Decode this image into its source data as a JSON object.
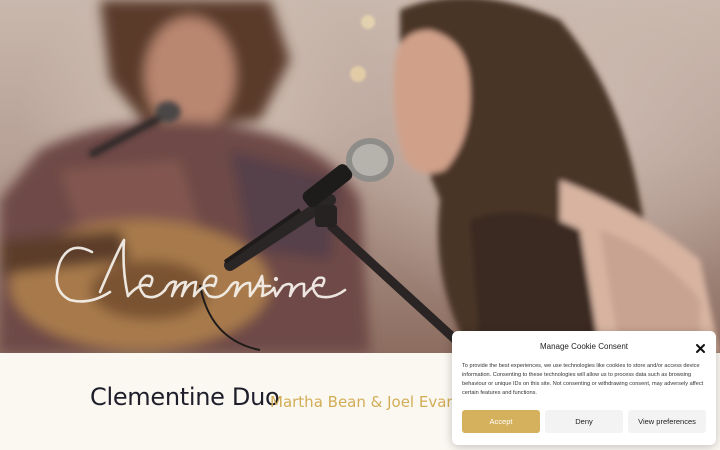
{
  "hero": {
    "logo_text": "Clementine"
  },
  "band": {
    "title": "Clementine Duo",
    "subtitle": "Martha Bean & Joel Evans"
  },
  "cookie": {
    "title": "Manage Cookie Consent",
    "close_icon": "close-icon",
    "body": "To provide the best experiences, we use technologies like cookies to store and/or access device information. Consenting to these technologies will allow us to process data such as browsing behaviour or unique IDs on this site. Not consenting or withdrawing consent, may adversely affect certain features and functions.",
    "accept_label": "Accept",
    "deny_label": "Deny",
    "prefs_label": "View preferences"
  },
  "colors": {
    "accent": "#d6b15d",
    "subtitle": "#d2ad55",
    "title": "#1f1f2b",
    "band_bg": "#fbf8f2"
  }
}
